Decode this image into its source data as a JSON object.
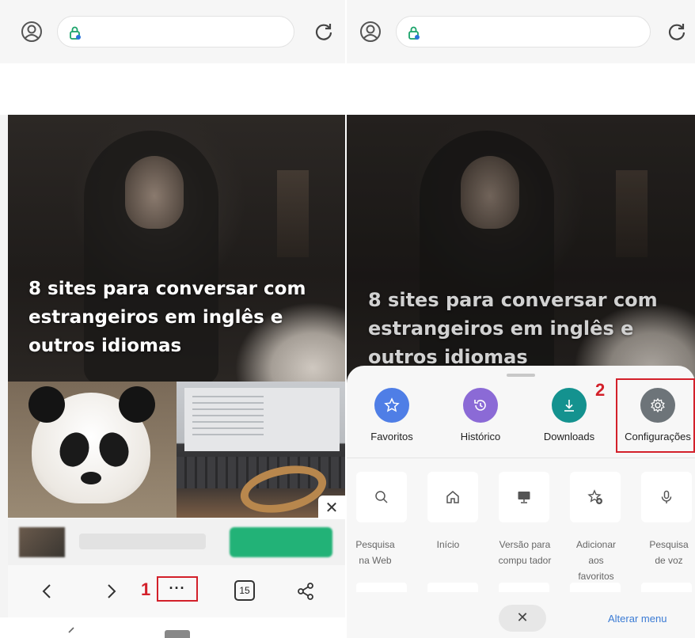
{
  "left": {
    "article_title": "8 sites para conversar com estrangeiros em inglês e outros idiomas",
    "ad_close_glyph": "✕",
    "nav": {
      "back_icon": "back-arrow-icon",
      "forward_icon": "forward-arrow-icon",
      "more_label": "···",
      "step_marker": "1",
      "tab_count": "15",
      "share_icon": "share-icon"
    }
  },
  "right": {
    "article_title": "8 sites para conversar com estrangeiros em inglês e outros idiomas",
    "step_marker": "2",
    "quick_actions": [
      {
        "label": "Favoritos",
        "icon": "star-icon",
        "color": "#4f7ee6"
      },
      {
        "label": "Histórico",
        "icon": "history-icon",
        "color": "#8b6ad6"
      },
      {
        "label": "Downloads",
        "icon": "download-icon",
        "color": "#14928f"
      },
      {
        "label": "Configurações",
        "icon": "gear-icon",
        "color": "#6d7479"
      }
    ],
    "tiles": [
      {
        "label": "Pesquisa na Web",
        "icon": "search-icon"
      },
      {
        "label": "Início",
        "icon": "home-icon"
      },
      {
        "label": "Versão para compu tador",
        "icon": "desktop-icon"
      },
      {
        "label": "Adicionar aos favoritos",
        "icon": "add-favorite-icon"
      },
      {
        "label": "Pesquisa de voz",
        "icon": "microphone-icon"
      }
    ],
    "close_glyph": "✕",
    "edit_menu_label": "Alterar menu"
  },
  "colors": {
    "highlight": "#d3202a",
    "link": "#3b7bd4"
  }
}
